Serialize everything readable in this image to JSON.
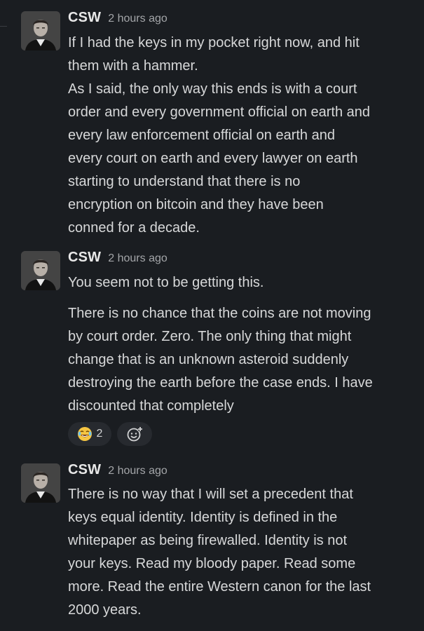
{
  "messages": [
    {
      "author": "CSW",
      "timestamp": "2 hours ago",
      "lines": [
        "If I had the keys in my pocket right now, and hit",
        "them with a hammer.",
        "As I said, the only way this ends is with a court",
        "order and every government official on earth and",
        "every law enforcement official on earth and",
        "every court on earth and every lawyer on earth",
        "starting to understand that there is no",
        "encryption on bitcoin and they have been",
        "conned for a decade."
      ]
    },
    {
      "author": "CSW",
      "timestamp": "2 hours ago",
      "lines": [
        "You seem not to be getting this."
      ],
      "lines2": [
        "There is no chance that the coins are not moving",
        "by court order. Zero. The only thing that might",
        "change that is an unknown asteroid suddenly",
        "destroying the earth before the case ends. I have",
        "discounted that completely"
      ],
      "reactions": [
        {
          "icon": "joy-emoji-icon",
          "count": "2"
        }
      ],
      "add_reaction_icon": "add-reaction-icon"
    },
    {
      "author": "CSW",
      "timestamp": "2 hours ago",
      "lines": [
        "There is no way that I will set a precedent that",
        "keys equal identity. Identity is defined in the",
        "whitepaper as being firewalled. Identity is not",
        "your keys. Read my bloody paper. Read some",
        "more. Read the entire Western canon for the last",
        "2000 years."
      ]
    }
  ],
  "colors": {
    "background": "#1a1d21",
    "text": "#d7d8d9",
    "timestamp": "#a4a6a9",
    "reaction_bg": "#272a2f"
  }
}
